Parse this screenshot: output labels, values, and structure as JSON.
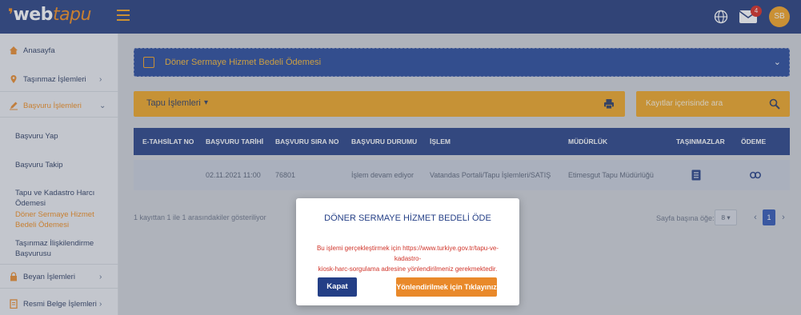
{
  "app": {
    "logo_web": "web",
    "logo_tapu": "tapu",
    "mail_count": "4",
    "avatar_initials": "SB",
    "colors": {
      "primary": "#243f86",
      "accent": "#f0a520",
      "alert": "#d0342a"
    }
  },
  "sidebar": {
    "items": [
      {
        "label": "Anasayfa",
        "icon": "home-icon"
      },
      {
        "label": "Taşınmaz İşlemleri",
        "icon": "location-pin-icon"
      },
      {
        "label": "Başvuru İşlemleri",
        "icon": "pen-icon"
      },
      {
        "label": "Beyan İşlemleri",
        "icon": "lock-icon"
      },
      {
        "label": "Resmi Belge İşlemleri",
        "icon": "document-icon"
      }
    ],
    "subitems": [
      "Başvuru Yap",
      "Başvuru Takip",
      "Tapu ve Kadastro Harcı Ödemesi",
      "Döner Sermaye Hizmet Bedeli Ödemesi",
      "Taşınmaz İlişkilendirme Başvurusu"
    ]
  },
  "panel": {
    "title": "Döner Sermaye Hizmet Bedeli Ödemesi"
  },
  "toolbar": {
    "dropdown_label": "Tapu İşlemleri",
    "search_placeholder": "Kayıtlar içerisinde ara"
  },
  "table": {
    "headers": [
      "E-TAHSİLAT NO",
      "BAŞVURU TARİHİ",
      "BAŞVURU SIRA NO",
      "BAŞVURU DURUMU",
      "İŞLEM",
      "MÜDÜRLÜK",
      "TAŞINMAZLAR",
      "ÖDEME"
    ],
    "rows": [
      {
        "etahsilat": "",
        "tarih": "02.11.2021 11:00",
        "sira_no": "76801",
        "durum": "İşlem devam ediyor",
        "islem": "Vatandas Portali/Tapu İşlemleri/SATIŞ",
        "mudurluk": "Etimesgut Tapu Müdürlüğü"
      }
    ]
  },
  "footer": {
    "info": "1 kayıttan 1 ile 1 arasındakiler gösteriliyor",
    "per_page_label": "Sayfa başına öğe:",
    "per_page_value": "8",
    "current_page": "1"
  },
  "modal": {
    "title": "DÖNER SERMAYE HİZMET BEDELİ ÖDE",
    "body_line1": "Bu işlemi gerçekleştirmek için https://www.turkiye.gov.tr/tapu-ve-kadastro-",
    "body_line2": "kiosk-harc-sorgulama adresine yönlendirilmeniz gerekmektedir.",
    "close_label": "Kapat",
    "redirect_label": "Yönlendirilmek için Tıklayınız"
  }
}
